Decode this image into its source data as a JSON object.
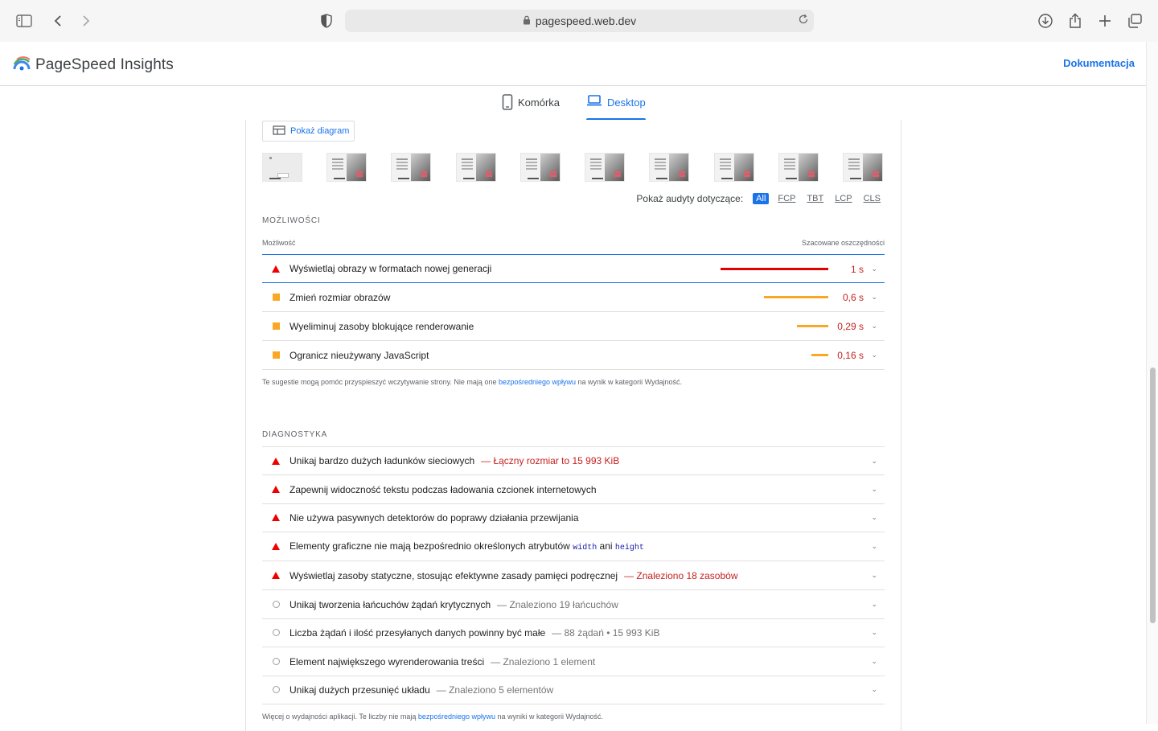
{
  "browser": {
    "url": "pagespeed.web.dev"
  },
  "app": {
    "title": "PageSpeed Insights",
    "docs_link": "Dokumentacja",
    "accent": "#1a73e8"
  },
  "tabs": [
    {
      "label": "Komórka",
      "icon": "mobile-icon",
      "active": false
    },
    {
      "label": "Desktop",
      "icon": "laptop-icon",
      "active": true
    }
  ],
  "diagram_button": "Pokaż diagram",
  "filmstrip_count": 10,
  "filter": {
    "label": "Pokaż audyty dotyczące:",
    "chips": [
      "All",
      "FCP",
      "TBT",
      "LCP",
      "CLS"
    ],
    "active": "All"
  },
  "opportunities": {
    "section_title": "MOŻLIWOŚCI",
    "col_left": "Możliwość",
    "col_right": "Szacowane oszczędności",
    "items": [
      {
        "title": "Wyświetlaj obrazy w formatach nowej generacji",
        "saving": "1 s",
        "severity": "fail",
        "saving_fraction": 1.0
      },
      {
        "title": "Zmień rozmiar obrazów",
        "saving": "0,6 s",
        "severity": "average",
        "saving_fraction": 0.6
      },
      {
        "title": "Wyeliminuj zasoby blokujące renderowanie",
        "saving": "0,29 s",
        "severity": "average",
        "saving_fraction": 0.29
      },
      {
        "title": "Ogranicz nieużywany JavaScript",
        "saving": "0,16 s",
        "severity": "average",
        "saving_fraction": 0.16
      }
    ],
    "note_pre": "Te sugestie mogą pomóc przyspieszyć wczytywanie strony. Nie mają one ",
    "note_link": "bezpośredniego wpływu",
    "note_post": " na wynik w kategorii Wydajność."
  },
  "diagnostics": {
    "section_title": "DIAGNOSTYKA",
    "items": [
      {
        "title": "Unikaj bardzo dużych ładunków sieciowych",
        "detail": "— Łączny rozmiar to 15 993 KiB",
        "severity": "fail"
      },
      {
        "title": "Zapewnij widoczność tekstu podczas ładowania czcionek internetowych",
        "detail": "",
        "severity": "fail"
      },
      {
        "title": "Nie używa pasywnych detektorów do poprawy działania przewijania",
        "detail": "",
        "severity": "fail"
      },
      {
        "title_pre": "Elementy graficzne nie mają bezpośrednio określonych atrybutów ",
        "code1": "width",
        "title_mid": " ani ",
        "code2": "height",
        "severity": "fail"
      },
      {
        "title": "Wyświetlaj zasoby statyczne, stosując efektywne zasady pamięci podręcznej",
        "detail": "— Znaleziono 18 zasobów",
        "severity": "fail"
      },
      {
        "title": "Unikaj tworzenia łańcuchów żądań krytycznych",
        "detail": "— Znaleziono 19 łańcuchów",
        "severity": "info"
      },
      {
        "title": "Liczba żądań i ilość przesyłanych danych powinny być małe",
        "detail": "— 88 żądań • 15 993 KiB",
        "severity": "info"
      },
      {
        "title": "Element największego wyrenderowania treści",
        "detail": "— Znaleziono 1 element",
        "severity": "info"
      },
      {
        "title": "Unikaj dużych przesunięć układu",
        "detail": "— Znaleziono 5 elementów",
        "severity": "info"
      }
    ],
    "note_pre": "Więcej o wydajności aplikacji. Te liczby nie mają ",
    "note_link": "bezpośredniego wpływu",
    "note_post": " na wyniki w kategorii Wydajność."
  },
  "colors": {
    "fail": "#e00000",
    "average": "#f9a825",
    "saving_text": "#c5221f"
  }
}
